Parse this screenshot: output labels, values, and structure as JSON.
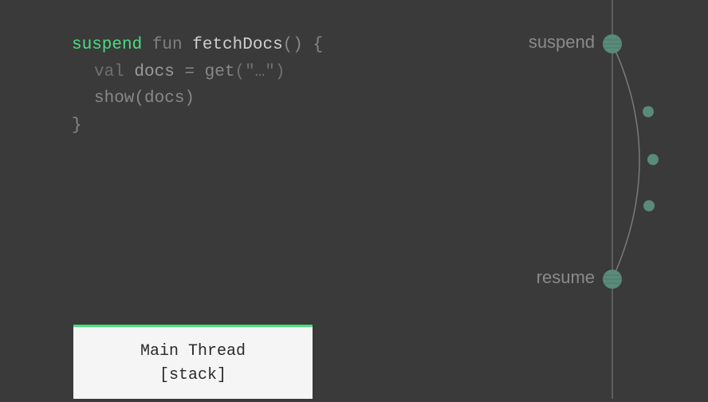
{
  "code": {
    "suspend_kw": "suspend",
    "fun_kw": "fun",
    "fn_name": "fetchDocs",
    "open_paren": "()",
    "open_brace": " {",
    "val_kw": "val",
    "var_docs": "docs",
    "assign": " = ",
    "get_fn": "get",
    "get_arg": "(\"…\")",
    "show_fn": "show",
    "show_arg": "(docs)",
    "close_brace": "}"
  },
  "diagram": {
    "label_suspend": "suspend",
    "label_resume": "resume"
  },
  "thread_box": {
    "title": "Main Thread",
    "subtitle": "[stack]"
  },
  "colors": {
    "accent_green": "#4ade80",
    "bg": "#3a3a3a",
    "muted": "#808080"
  }
}
